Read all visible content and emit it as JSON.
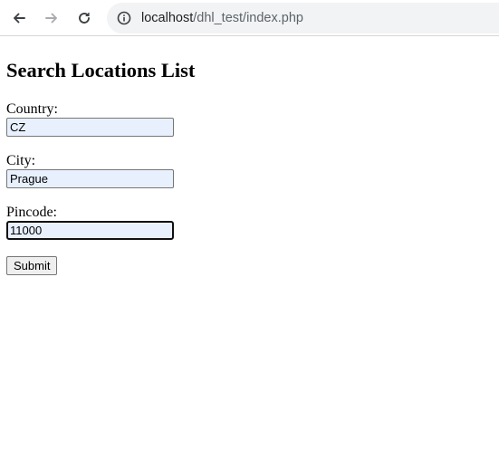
{
  "browser": {
    "url_host": "localhost",
    "url_path": "/dhl_test/index.php"
  },
  "page": {
    "title": "Search Locations List"
  },
  "form": {
    "country": {
      "label": "Country:",
      "value": "CZ"
    },
    "city": {
      "label": "City:",
      "value": "Prague"
    },
    "pincode": {
      "label": "Pincode:",
      "value": "11000"
    },
    "submit_label": "Submit"
  }
}
